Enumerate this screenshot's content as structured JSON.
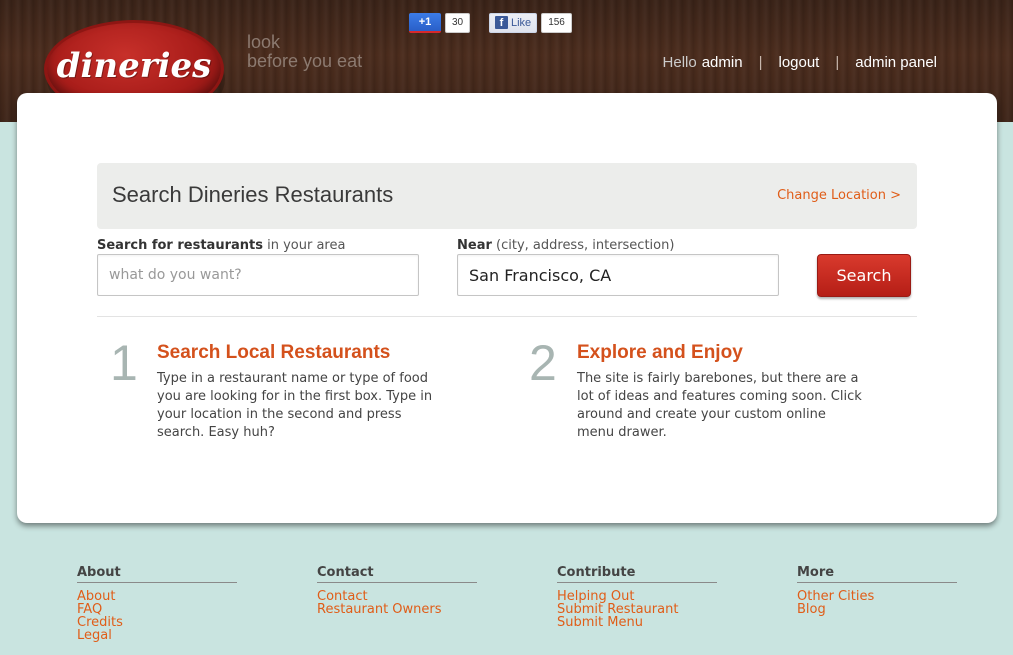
{
  "header": {
    "logo_text": "dineries",
    "tagline_line1": "look",
    "tagline_line2": "before you eat",
    "gplus": {
      "label": "+1",
      "count": "30"
    },
    "facebook": {
      "label": "Like",
      "count": "156",
      "icon_letter": "f"
    },
    "user": {
      "greeting": "Hello",
      "username": "admin",
      "logout": "logout",
      "admin_panel": "admin panel",
      "separator": "|"
    }
  },
  "search": {
    "title": "Search Dineries Restaurants",
    "change_location": "Change Location >",
    "what_label_bold": "Search for restaurants",
    "what_label_rest": " in your area",
    "what_placeholder": "what do you want?",
    "near_label_bold": "Near",
    "near_label_rest": " (city, address, intersection)",
    "near_value": "San Francisco, CA",
    "button": "Search"
  },
  "steps": [
    {
      "number": "1",
      "title": "Search Local Restaurants",
      "body": "Type in a restaurant name or type of food you are looking for in the first box. Type in your location in the second and press search. Easy huh?"
    },
    {
      "number": "2",
      "title": "Explore and Enjoy",
      "body": "The site is fairly barebones, but there are a lot of ideas and features coming soon. Click around and create your custom online menu drawer."
    }
  ],
  "footer": [
    {
      "heading": "About",
      "links": [
        "About",
        "FAQ",
        "Credits",
        "Legal"
      ]
    },
    {
      "heading": "Contact",
      "links": [
        "Contact",
        "Restaurant Owners"
      ]
    },
    {
      "heading": "Contribute",
      "links": [
        "Helping Out",
        "Submit Restaurant",
        "Submit Menu"
      ]
    },
    {
      "heading": "More",
      "links": [
        "Other Cities",
        "Blog"
      ]
    }
  ],
  "colors": {
    "accent_orange": "#e05d18",
    "brand_red": "#b51e16",
    "wood_brown": "#4b2c1d",
    "background_mint": "#c9e4e0"
  }
}
